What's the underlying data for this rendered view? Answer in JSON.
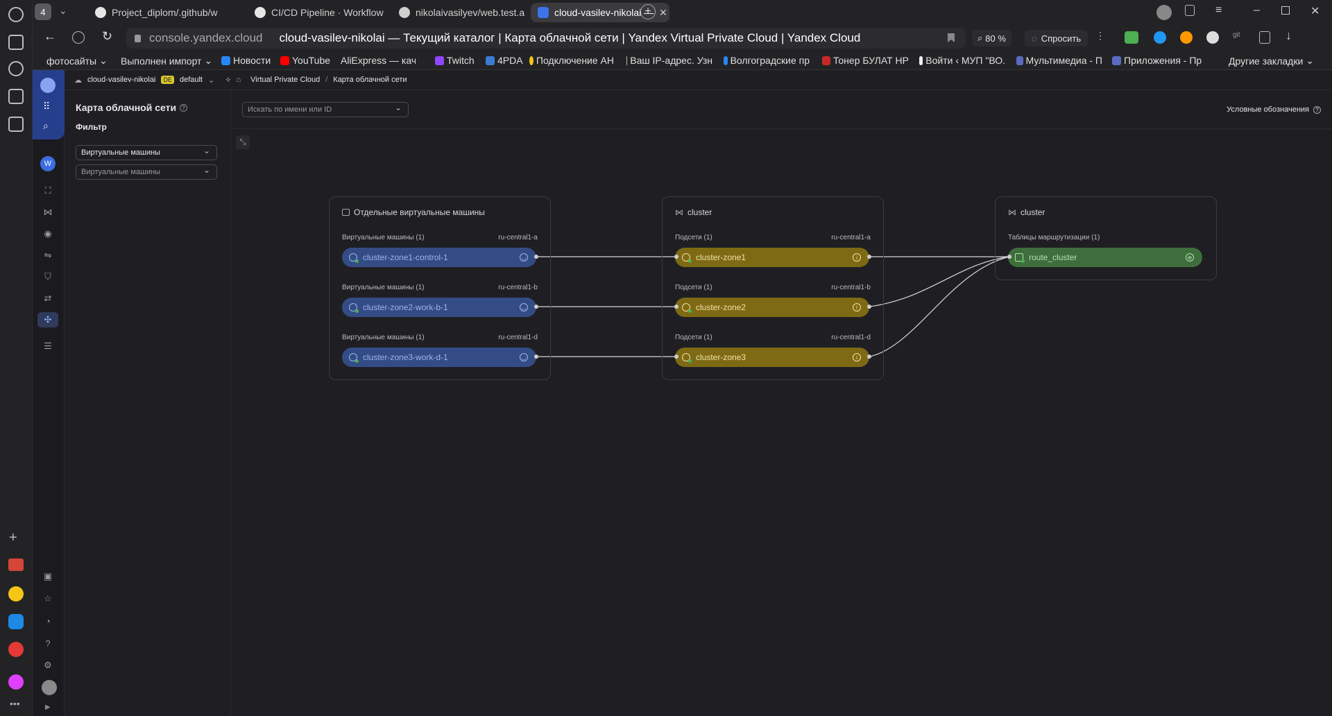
{
  "browser": {
    "tab_count": "4",
    "tabs": [
      {
        "label": "Project_diplom/.github/w"
      },
      {
        "label": "CI/CD Pipeline · Workflow"
      },
      {
        "label": "nikolaivasilyev/web.test.a"
      },
      {
        "label": "cloud-vasilev-nikolai —"
      }
    ],
    "url_host": "console.yandex.cloud",
    "page_title": "cloud-vasilev-nikolai — Текущий каталог | Карта облачной сети | Yandex Virtual Private Cloud | Yandex Cloud",
    "zoom": "80 %",
    "ask_label": "Спросить",
    "bookmarks": [
      "фотосайты",
      "Выполнен импорт",
      "Новости",
      "YouTube",
      "AliExpress — каче",
      "Twitch",
      "4PDA",
      "Подключение АН",
      "Ваш IP-адрес. Узн",
      "Волгоградские пр",
      "Тонер БУЛАТ HP",
      "Войти ‹ МУП \"ВО.",
      "Мультимедиа - П",
      "Приложения - Пр"
    ],
    "other_bookmarks": "Другие закладки"
  },
  "breadcrumb": {
    "cloud": "cloud-vasilev-nikolai",
    "folder_badge": "DE",
    "folder": "default",
    "service": "Virtual Private Cloud",
    "page": "Карта облачной сети"
  },
  "sidebar": {
    "title": "Карта облачной сети",
    "filter_label": "Фильтр",
    "filter_value": "Виртуальные машины",
    "filter_placeholder": "Виртуальные машины"
  },
  "toolbar": {
    "search_placeholder": "Искать по имени или ID",
    "legend_label": "Условные обозначения"
  },
  "map": {
    "vm_group": {
      "title": "Отдельные виртуальные машины",
      "rows": [
        {
          "section": "Виртуальные машины (1)",
          "zone": "ru-central1-a",
          "name": "cluster-zone1-control-1"
        },
        {
          "section": "Виртуальные машины (1)",
          "zone": "ru-central1-b",
          "name": "cluster-zone2-work-b-1"
        },
        {
          "section": "Виртуальные машины (1)",
          "zone": "ru-central1-d",
          "name": "cluster-zone3-work-d-1"
        }
      ]
    },
    "subnet_group": {
      "title": "cluster",
      "rows": [
        {
          "section": "Подсети (1)",
          "zone": "ru-central1-a",
          "name": "cluster-zone1"
        },
        {
          "section": "Подсети (1)",
          "zone": "ru-central1-b",
          "name": "cluster-zone2"
        },
        {
          "section": "Подсети (1)",
          "zone": "ru-central1-d",
          "name": "cluster-zone3"
        }
      ]
    },
    "route_group": {
      "title": "cluster",
      "section": "Таблицы маршрутизации (1)",
      "name": "route_cluster"
    }
  },
  "colors": {
    "vm": "#344c86",
    "subnet": "#7e6a14",
    "route": "#3f6e3d",
    "accent": "#4f6fd6"
  }
}
